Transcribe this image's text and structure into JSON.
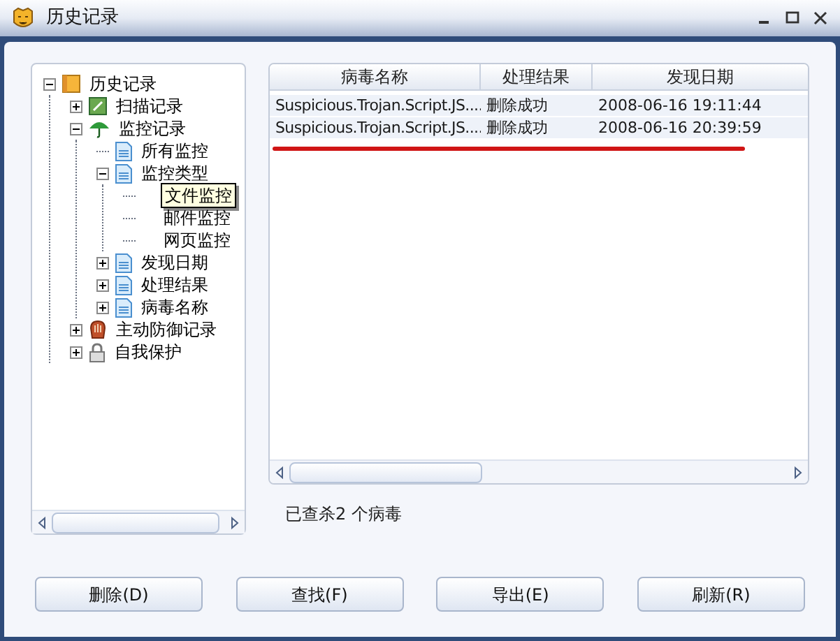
{
  "window": {
    "title": "历史记录"
  },
  "tree": [
    {
      "label": "历史记录",
      "kind": "book",
      "expanded": true,
      "children": [
        {
          "label": "扫描记录",
          "kind": "scan",
          "expanded": false
        },
        {
          "label": "监控记录",
          "kind": "umbrella",
          "expanded": true,
          "children": [
            {
              "label": "所有监控",
              "kind": "doc"
            },
            {
              "label": "监控类型",
              "kind": "doc",
              "expanded": true,
              "children": [
                {
                  "label": "文件监控",
                  "kind": "plain",
                  "hovered": true
                },
                {
                  "label": "邮件监控",
                  "kind": "plain",
                  "hovered": false
                },
                {
                  "label": "网页监控",
                  "kind": "plain",
                  "hovered": false
                }
              ]
            },
            {
              "label": "发现日期",
              "kind": "doc",
              "expanded": false
            },
            {
              "label": "处理结果",
              "kind": "doc",
              "expanded": false
            },
            {
              "label": "病毒名称",
              "kind": "doc",
              "expanded": false
            }
          ]
        },
        {
          "label": "主动防御记录",
          "kind": "glove",
          "expanded": false
        },
        {
          "label": "自我保护",
          "kind": "lock",
          "expanded": false
        }
      ]
    }
  ],
  "table": {
    "columns": [
      "病毒名称",
      "处理结果",
      "发现日期"
    ],
    "rows": [
      [
        "Suspicious.Trojan.Script.JS....",
        "删除成功",
        "2008-06-16 19:11:44"
      ],
      [
        "Suspicious.Trojan.Script.JS....",
        "删除成功",
        "2008-06-16 20:39:59"
      ]
    ]
  },
  "status": "已查杀2 个病毒",
  "buttons": [
    "删除(D)",
    "查找(F)",
    "导出(E)",
    "刷新(R)"
  ]
}
